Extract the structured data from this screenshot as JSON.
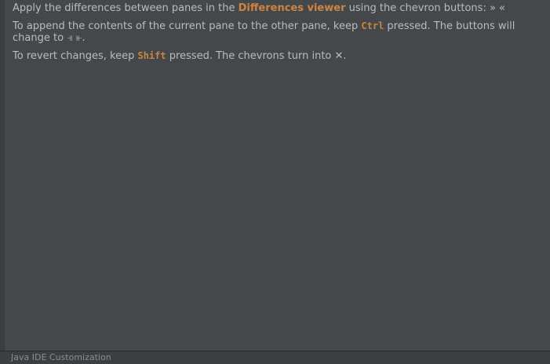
{
  "tip": {
    "line1": {
      "prefix": "Apply the differences between panes in the ",
      "highlight": "Differences viewer",
      "suffix": " using the chevron buttons: ",
      "glyphs": "» «"
    },
    "line2": {
      "prefix": "To append the contents of the current pane to the other pane, keep ",
      "key": "Ctrl",
      "suffix": " pressed. The buttons will change to ",
      "glyphs": "⫣ ⫦",
      "end": "."
    },
    "line3": {
      "prefix": "To revert changes, keep ",
      "key": "Shift",
      "suffix": " pressed. The chevrons turn into ",
      "glyph": "✕",
      "end": "."
    }
  },
  "statusbar": {
    "text": "Java IDE Customization"
  }
}
